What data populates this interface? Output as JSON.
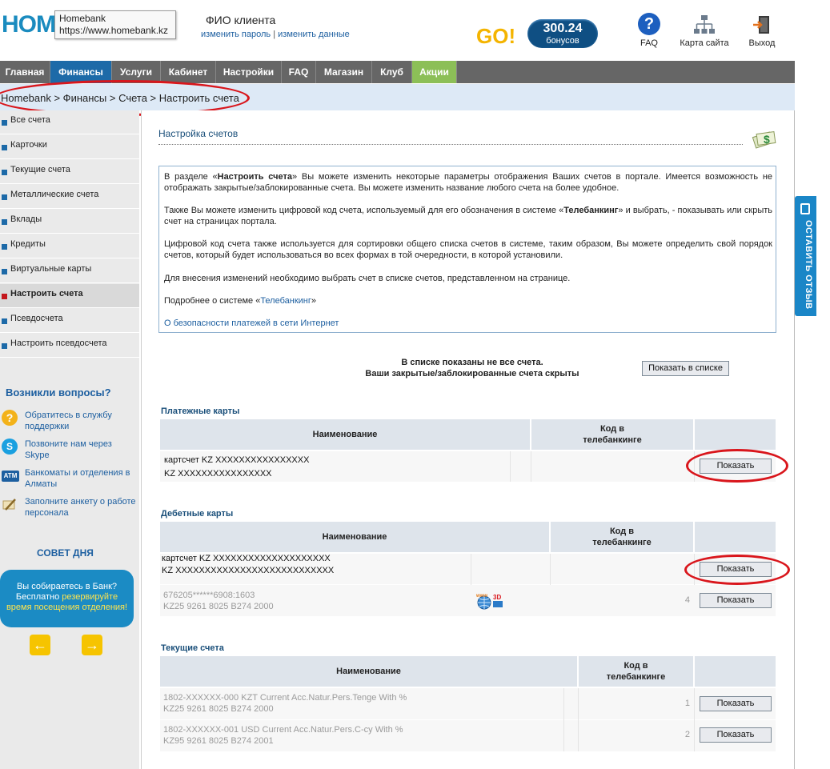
{
  "header": {
    "logo_text": "HOME",
    "tooltip_title": "Homebank",
    "tooltip_url": "https://www.homebank.kz",
    "client_name": "ФИО клиента",
    "change_password": "изменить пароль",
    "link_separator": "|",
    "change_data": "изменить данные",
    "go_logo": "GO!",
    "bonus_amount": "300.24",
    "bonus_label": "бонусов",
    "faq_label": "FAQ",
    "faq_icon": "question-icon",
    "sitemap_label": "Карта сайта",
    "sitemap_icon": "sitemap-icon",
    "logout_label": "Выход",
    "logout_icon": "door-exit-icon"
  },
  "nav": {
    "items": [
      "Главная",
      "Финансы",
      "Услуги",
      "Кабинет",
      "Настройки",
      "FAQ",
      "Магазин",
      "Клуб",
      "Акции"
    ]
  },
  "breadcrumb": "Homebank > Финансы > Счета > Настроить счета",
  "sidebar": {
    "items": [
      "Все счета",
      "Карточки",
      "Текущие счета",
      "Металлические счета",
      "Вклады",
      "Кредиты",
      "Виртуальные карты",
      "Настроить счета",
      "Псевдосчета",
      "Настроить псевдосчета"
    ],
    "help_title": "Возникли вопросы?",
    "help": [
      {
        "icon": "support-icon",
        "text": "Обратитесь в службу поддержки"
      },
      {
        "icon": "skype-icon",
        "text": "Позвоните нам через Skype"
      },
      {
        "icon": "atm-icon",
        "text": "Банкоматы и отделения в Алматы"
      },
      {
        "icon": "pencil-icon",
        "text": "Заполните анкету о работе персонала"
      }
    ],
    "tip_title": "СОВЕТ ДНЯ",
    "tip_line1": "Вы собираетесь в Банк?",
    "tip_line2a": "Бесплатно ",
    "tip_line2b": "резервируйте",
    "tip_line3": "время посещения отделения!",
    "prev_icon": "arrow-left-icon",
    "next_icon": "arrow-right-icon"
  },
  "main": {
    "title": "Настройка счетов",
    "info": {
      "p1_a": "В разделе «",
      "p1_b": "Настроить счета",
      "p1_c": "» Вы можете изменить некоторые параметры отображения Ваших счетов в портале. Имеется возможность не отображать закрытые/заблокированные счета. Вы можете изменить название любого счета на более удобное.",
      "p2_a": "Также Вы можете изменить цифровой код счета, используемый для его обозначения в системе «",
      "p2_b": "Телебанкинг",
      "p2_c": "» и выбрать, - показывать или скрыть счет на страницах портала.",
      "p3": "Цифровой код счета также используется для сортировки общего списка счетов в системе, таким образом, Вы можете определить свой порядок счетов, который будет использоваться во всех формах в той очередности, в которой установили.",
      "p4": "Для внесения изменений необходимо выбрать счет в списке счетов, представленном на странице.",
      "p5_a": "Подробнее о системе «",
      "p5_b": "Телебанкинг",
      "p5_c": "»",
      "p6": "О безопасности платежей в сети Интернет"
    },
    "notice_line1": "В списке показаны не все счета.",
    "notice_line2": "Ваши закрытые/заблокированные счета скрыты",
    "show_in_list": "Показать в списке",
    "col_name": "Наименование",
    "col_code_1": "Код в",
    "col_code_2": "телебанкинге",
    "show_btn": "Показать",
    "payment_cards": {
      "title": "Платежные карты",
      "rows": [
        {
          "line1": "картсчет KZ XXXXXXXXXXXXXXXX",
          "line2": "KZ XXXXXXXXXXXXXXXX",
          "code": ""
        }
      ]
    },
    "debit_cards": {
      "title": "Дебетные карты",
      "rows": [
        {
          "line1": "картсчет KZ XXXXXXXXXXXXXXXXXXXX",
          "line2": "KZ XXXXXXXXXXXXXXXXXXXXXXXXXXX",
          "code": ""
        },
        {
          "line1": "676205******6908:1603",
          "line2": "KZ25 9261 8025 B274 2000",
          "code": "4",
          "badge_icon": "www-3d-secure-icon"
        }
      ]
    },
    "current_accounts": {
      "title": "Текущие счета",
      "rows": [
        {
          "line1": "1802-XXXXXX-000 KZT Current Acc.Natur.Pers.Tenge With %",
          "line2": "KZ25 9261 8025 B274 2000",
          "code": "1"
        },
        {
          "line1": "1802-XXXXXX-001 USD Current Acc.Natur.Pers.C-cy With %",
          "line2": "KZ95 9261 8025 B274 2001",
          "code": "2"
        }
      ]
    }
  },
  "feedback_tab": "ОСТАВИТЬ ОТЗЫВ",
  "feedback_icon": "feedback-icon",
  "colors": {
    "nav_bg": "#666666",
    "nav_active": "#1d6aa8",
    "nav_promo": "#8cbf57",
    "annotation_red": "#d9161c"
  }
}
